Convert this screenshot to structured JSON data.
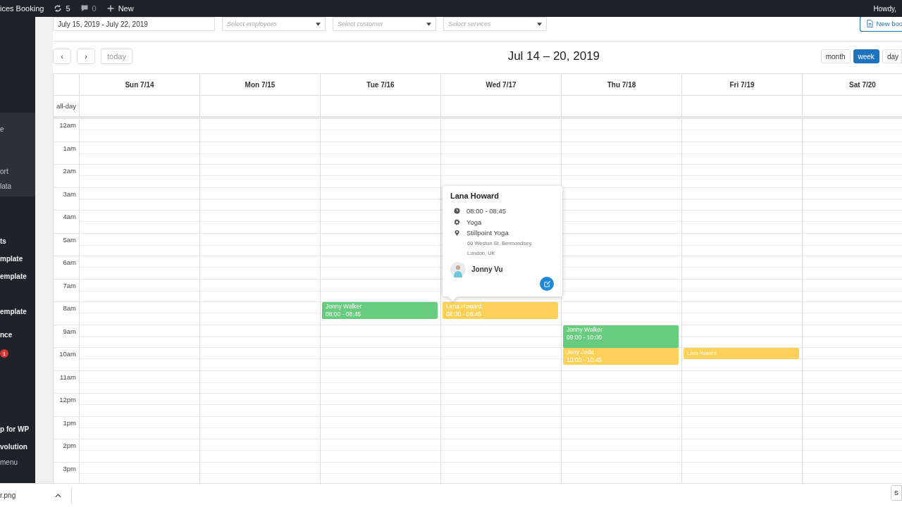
{
  "admin_bar": {
    "site_name": "ices Booking",
    "updates": "5",
    "comments": "0",
    "new_label": "New",
    "greeting": "Howdy,"
  },
  "sidebar": {
    "groups": [
      {
        "kind": "submenu",
        "items": [
          "e",
          "ort",
          "lata"
        ]
      },
      {
        "kind": "menu",
        "items": [
          "ts",
          "mplate",
          "emplate"
        ]
      },
      {
        "kind": "menu",
        "items": [
          "emplate",
          "nce"
        ],
        "badge": "1"
      },
      {
        "kind": "menu",
        "items": [
          "p for WP",
          "volution",
          "menu"
        ]
      }
    ]
  },
  "filters": {
    "date_range": "July 15, 2019 - July 22, 2019",
    "selects": [
      {
        "placeholder": "Select employees"
      },
      {
        "placeholder": "Select customer"
      },
      {
        "placeholder": "Select services"
      }
    ],
    "new_button": "New boo"
  },
  "toolbar": {
    "nav": [
      {
        "label": "‹",
        "disabled": false
      },
      {
        "label": "›",
        "disabled": false
      },
      {
        "label": "today",
        "disabled": true
      }
    ],
    "title": "Jul 14 – 20, 2019",
    "views": [
      {
        "label": "month",
        "selected": false
      },
      {
        "label": "week",
        "selected": true
      },
      {
        "label": "day",
        "selected": false
      }
    ]
  },
  "calendar": {
    "days": [
      "Sun 7/14",
      "Mon 7/15",
      "Tue 7/16",
      "Wed 7/17",
      "Thu 7/18",
      "Fri 7/19",
      "Sat 7/20"
    ],
    "all_day_label": "all-day",
    "hours": [
      {
        "label": "12am"
      },
      {
        "label": "1am"
      },
      {
        "label": "2am"
      },
      {
        "label": "3am"
      },
      {
        "label": "4am"
      },
      {
        "label": "5am"
      },
      {
        "label": "6am"
      },
      {
        "label": "7am"
      },
      {
        "label": "8am",
        "cells": [
          null,
          null,
          {
            "kind": "three_quarter",
            "name": "Jonny Walker",
            "time": "08:00 - 08:45",
            "color": "#67cc7d"
          },
          {
            "kind": "three_quarter",
            "name": "Lana Howard",
            "time": "08:00 - 08:45",
            "color": "#fcd159",
            "popover": {
              "title": "Lana Howard",
              "time": "08:00 - 08:45",
              "service": "Yoga",
              "location": "Stillpoint Yoga",
              "address": "60 Weston St, Bermondsey. London, UK",
              "employee": "Jonny Vu"
            }
          },
          null,
          null,
          null
        ]
      },
      {
        "label": "9am",
        "cells": [
          null,
          null,
          null,
          null,
          {
            "kind": "hour",
            "name": "Jonny Walker",
            "time": "09:00 - 10:00",
            "color": "#67cc7d"
          },
          null,
          null
        ]
      },
      {
        "label": "10am",
        "cells": [
          null,
          null,
          null,
          null,
          {
            "kind": "three_quarter",
            "name": "Jeny Jeda",
            "time": "10:00 - 10:45",
            "color": "#fcd159"
          },
          {
            "kind": "half",
            "name": "Lana Howard",
            "color": "#fcd159"
          },
          null
        ]
      },
      {
        "label": "11am"
      },
      {
        "label": "12pm"
      },
      {
        "label": "1pm"
      },
      {
        "label": "2pm"
      },
      {
        "label": "3pm"
      }
    ]
  },
  "downloads": {
    "file": "r.png",
    "button": "S"
  }
}
